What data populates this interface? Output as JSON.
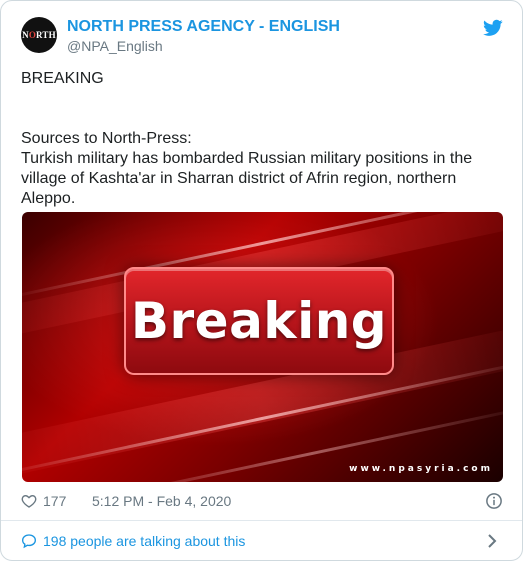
{
  "author": {
    "avatar_text_a": "N",
    "avatar_text_b": "O",
    "avatar_text_c": "RTH",
    "display_name": "NORTH PRESS AGENCY - ENGLISH",
    "handle": "@NPA_English"
  },
  "tweet": {
    "line1": "BREAKING",
    "line2": "Sources to North-Press:",
    "line3": "Turkish military has bombarded Russian military positions in the village of Kashta'ar in Sharran district of Afrin region, northern Aleppo."
  },
  "media": {
    "headline": "Breaking",
    "watermark": "www.npasyria.com"
  },
  "footer": {
    "likes": "177",
    "timestamp": "5:12 PM - Feb 4, 2020",
    "conversation": "198 people are talking about this"
  },
  "colors": {
    "link": "#1b95e0",
    "muted": "#697882",
    "border": "#cfd9de"
  },
  "icons": [
    "twitter-bird-icon",
    "heart-icon",
    "info-icon",
    "speech-bubble-icon",
    "chevron-right-icon"
  ]
}
